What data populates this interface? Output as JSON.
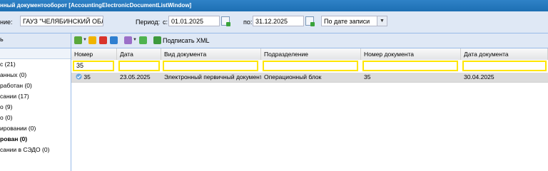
{
  "window": {
    "title": "нный документооборот [AccountingElectronicDocumentListWindow]"
  },
  "filters": {
    "org_label": "ние:",
    "org_value": "ГАУЗ \"ЧЕЛЯБИНСКИЙ ОБЛАСТНО",
    "period_label": "Период:",
    "from_label": "с:",
    "from_value": "01.01.2025",
    "to_label": "по:",
    "to_value": "31.12.2025",
    "date_mode_value": "По дате записи"
  },
  "left_panel": {
    "header": "ь",
    "items": [
      {
        "label": "с (21)",
        "bold": false
      },
      {
        "label": "анных (0)",
        "bold": false
      },
      {
        "label": "работан (0)",
        "bold": false
      },
      {
        "label": "сании (17)",
        "bold": false
      },
      {
        "label": "о (9)",
        "bold": false
      },
      {
        "label": "о (0)",
        "bold": false
      },
      {
        "label": "ировании (0)",
        "bold": false
      },
      {
        "label": "рован (0)",
        "bold": true
      },
      {
        "label": "сании в СЭДО (0)",
        "bold": false
      }
    ]
  },
  "toolbar": {
    "sign_xml_label": "Подписать XML"
  },
  "grid": {
    "columns": [
      "Номер",
      "Дата",
      "Вид документа",
      "Подразделение",
      "Номер документа",
      "Дата документа"
    ],
    "filter_values": [
      "35",
      "",
      "",
      "",
      "",
      ""
    ],
    "rows": [
      [
        "35",
        "23.05.2025",
        "Электронный первичный документ",
        "Операционный блок",
        "35",
        "30.04.2025"
      ]
    ]
  },
  "colors": {
    "title_bar": "#1d6fb3",
    "panel_bg": "#dfe8f5",
    "filter_highlight": "#ffe600",
    "selected_row": "#dcdcdc"
  }
}
